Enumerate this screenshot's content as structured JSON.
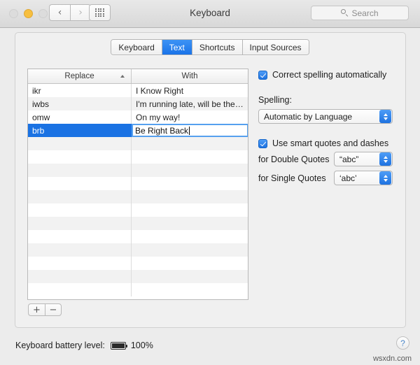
{
  "window": {
    "title": "Keyboard",
    "traffic_lights": [
      "close",
      "minimize",
      "zoom"
    ]
  },
  "toolbar": {
    "back_glyph": "‹",
    "forward_glyph": "›",
    "grid_button_name": "show-all-preferences",
    "search": {
      "placeholder": "Search",
      "value": ""
    }
  },
  "tabs": [
    {
      "label": "Keyboard",
      "active": false
    },
    {
      "label": "Text",
      "active": true
    },
    {
      "label": "Shortcuts",
      "active": false
    },
    {
      "label": "Input Sources",
      "active": false
    }
  ],
  "table": {
    "columns": [
      {
        "label": "Replace",
        "sorted": "ascending"
      },
      {
        "label": "With",
        "sorted": null
      }
    ],
    "rows": [
      {
        "replace": "ikr",
        "with": "I Know Right",
        "selected": false,
        "editing": false
      },
      {
        "replace": "iwbs",
        "with": "I'm running late, will be the…",
        "selected": false,
        "editing": false
      },
      {
        "replace": "omw",
        "with": "On my way!",
        "selected": false,
        "editing": false
      },
      {
        "replace": "brb",
        "with": "Be Right Back",
        "selected": true,
        "editing": true
      }
    ],
    "empty_row_count": 12,
    "edit_value": "Be Right Back"
  },
  "table_controls": {
    "add_label": "+",
    "remove_label": "−"
  },
  "options": {
    "correct_spelling": {
      "label": "Correct spelling automatically",
      "checked": true
    },
    "spelling_heading": "Spelling:",
    "spelling_popup": {
      "value": "Automatic by Language"
    },
    "smart_quotes": {
      "label": "Use smart quotes and dashes",
      "checked": true
    },
    "double_quotes": {
      "label": "for Double Quotes",
      "value": "“abc”"
    },
    "single_quotes": {
      "label": "for Single Quotes",
      "value": "‘abc’"
    }
  },
  "footer": {
    "battery_label": "Keyboard battery level:",
    "battery_percent": "100%",
    "help_glyph": "?",
    "watermark": "wsxdn.com"
  },
  "colors": {
    "accent_blue": "#1a72e3",
    "tab_active": "#2a84ef",
    "window_chrome": "#ececec",
    "panel": "#f0f0f0"
  }
}
